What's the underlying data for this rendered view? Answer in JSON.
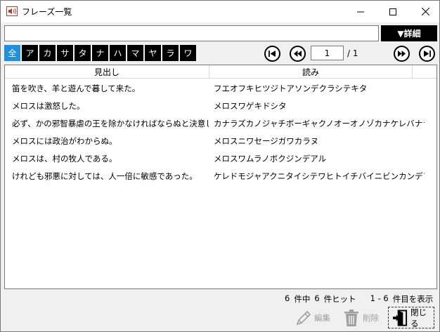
{
  "window": {
    "title": "フレーズ一覧"
  },
  "search": {
    "value": "",
    "detail_label": "▼詳細"
  },
  "kana_filters": [
    "全",
    "ア",
    "カ",
    "サ",
    "タ",
    "ナ",
    "ハ",
    "マ",
    "ヤ",
    "ラ",
    "ワ"
  ],
  "pager": {
    "current": "1",
    "total": "/ 1"
  },
  "grid": {
    "headers": {
      "heading": "見出し",
      "reading": "読み"
    },
    "rows": [
      {
        "heading": "笛を吹き、羊と遊んで暮して来た。",
        "reading": "フエオフキヒツジトアソンデクラシテキタ"
      },
      {
        "heading": "メロスは激怒した。",
        "reading": "メロスワゲキドシタ"
      },
      {
        "heading": "必ず、かの邪智暴虐の王を除かなければならぬと決意した。",
        "reading": "カナラズカノジャチボーギャクノオーオノゾカナケレバナラヌトケツ"
      },
      {
        "heading": "メロスには政治がわからぬ。",
        "reading": "メロスニワセージガワカラヌ"
      },
      {
        "heading": "メロスは、村の牧人である。",
        "reading": "メロスワムラノボクジンデアル"
      },
      {
        "heading": "けれども邪悪に対しては、人一倍に敏感であった。",
        "reading": "ケレドモジャアクニタイシテワヒトイチバイニビンカンデアッタ"
      }
    ]
  },
  "summary": {
    "total": "6",
    "total_unit": "件中",
    "hits": "6",
    "hits_unit": "件ヒット",
    "range": "1 - 6",
    "range_unit": "件目を表示"
  },
  "footer": {
    "edit_label": "編集",
    "delete_label": "削除",
    "close_label": "閉じる"
  },
  "colors": {
    "accent": "#1e90e0",
    "button_bg": "#000000",
    "disabled": "#a0a0a0"
  }
}
